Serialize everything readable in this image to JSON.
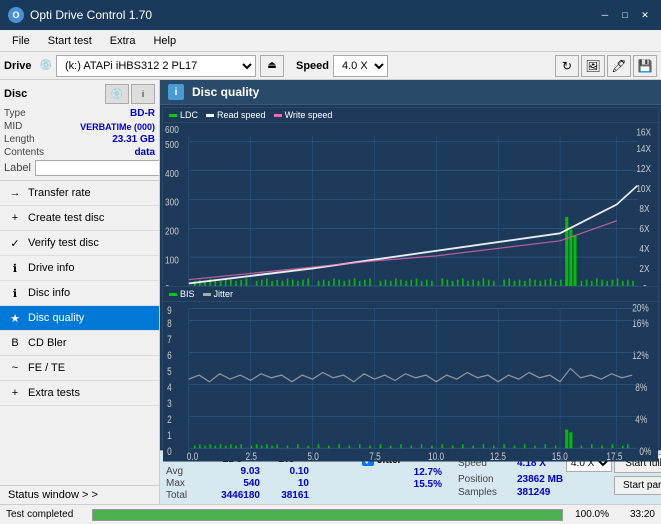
{
  "titlebar": {
    "title": "Opti Drive Control 1.70",
    "minimize_label": "─",
    "maximize_label": "□",
    "close_label": "✕"
  },
  "menubar": {
    "items": [
      "File",
      "Start test",
      "Extra",
      "Help"
    ]
  },
  "toolbar": {
    "drive_label": "Drive",
    "drive_value": "(k:) ATAPi iHBS312  2 PL17",
    "speed_label": "Speed",
    "speed_value": "4.0 X"
  },
  "disc": {
    "title": "Disc",
    "type_label": "Type",
    "type_value": "BD-R",
    "mid_label": "MID",
    "mid_value": "VERBATIMe (000)",
    "length_label": "Length",
    "length_value": "23.31 GB",
    "contents_label": "Contents",
    "contents_value": "data",
    "label_label": "Label",
    "label_value": ""
  },
  "nav": {
    "items": [
      {
        "id": "transfer-rate",
        "label": "Transfer rate",
        "icon": "→"
      },
      {
        "id": "create-test-disc",
        "label": "Create test disc",
        "icon": "+"
      },
      {
        "id": "verify-test-disc",
        "label": "Verify test disc",
        "icon": "✓"
      },
      {
        "id": "drive-info",
        "label": "Drive info",
        "icon": "i"
      },
      {
        "id": "disc-info",
        "label": "Disc info",
        "icon": "i"
      },
      {
        "id": "disc-quality",
        "label": "Disc quality",
        "icon": "★",
        "active": true
      },
      {
        "id": "cd-bler",
        "label": "CD Bler",
        "icon": "B"
      },
      {
        "id": "fe-te",
        "label": "FE / TE",
        "icon": "~"
      },
      {
        "id": "extra-tests",
        "label": "Extra tests",
        "icon": "+"
      }
    ]
  },
  "status_window": {
    "label": "Status window  > >"
  },
  "dq": {
    "title": "Disc quality",
    "icon_label": "i",
    "legend1": {
      "ldc_label": "LDC",
      "read_label": "Read speed",
      "write_label": "Write speed"
    },
    "legend2": {
      "bis_label": "BIS",
      "jitter_label": "Jitter"
    }
  },
  "stats": {
    "ldc_header": "LDC",
    "bis_header": "BIS",
    "jitter_label": "Jitter",
    "speed_label": "Speed",
    "speed_value": "4.18 X",
    "speed_selector": "4.0 X",
    "position_label": "Position",
    "position_value": "23862 MB",
    "samples_label": "Samples",
    "samples_value": "381249",
    "avg_label": "Avg",
    "avg_ldc": "9.03",
    "avg_bis": "0.10",
    "avg_jitter": "12.7%",
    "max_label": "Max",
    "max_ldc": "540",
    "max_bis": "10",
    "max_jitter": "15.5%",
    "total_label": "Total",
    "total_ldc": "3446180",
    "total_bis": "38161",
    "start_full_label": "Start full",
    "start_part_label": "Start part"
  },
  "bottombar": {
    "status": "Test completed",
    "progress": 100,
    "percent": "100.0%",
    "time": "33:20"
  },
  "colors": {
    "ldc": "#00cc00",
    "read_speed": "#ffffff",
    "write_speed": "#ff69b4",
    "bis": "#00cc00",
    "jitter": "#cccccc",
    "chart_bg": "#1e3a5a",
    "grid": "#2a5a8a"
  }
}
